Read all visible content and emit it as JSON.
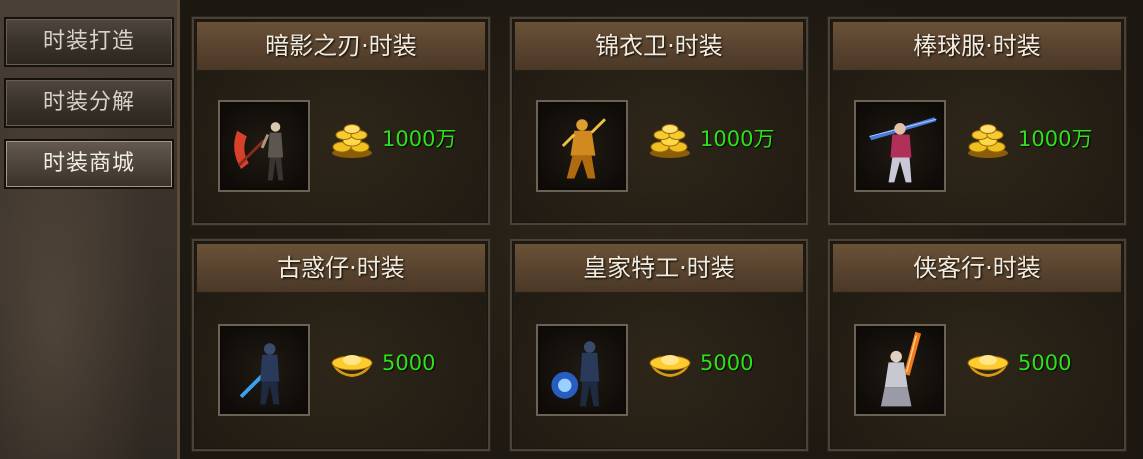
{
  "sidebar": {
    "tabs": [
      {
        "label": "时装打造",
        "active": false
      },
      {
        "label": "时装分解",
        "active": false
      },
      {
        "label": "时装商城",
        "active": true
      }
    ]
  },
  "shop": {
    "items": [
      {
        "name": "暗影之刃·时装",
        "price": "1000万",
        "currency_icon": "gold-coins-icon",
        "portrait_icon": "scythe-warrior-icon"
      },
      {
        "name": "锦衣卫·时装",
        "price": "1000万",
        "currency_icon": "gold-coins-icon",
        "portrait_icon": "golden-warrior-icon"
      },
      {
        "name": "棒球服·时装",
        "price": "1000万",
        "currency_icon": "gold-coins-icon",
        "portrait_icon": "sword-fighter-icon"
      },
      {
        "name": "古惑仔·时装",
        "price": "5000",
        "currency_icon": "gold-ingot-icon",
        "portrait_icon": "blue-blade-warrior-icon"
      },
      {
        "name": "皇家特工·时装",
        "price": "5000",
        "currency_icon": "gold-ingot-icon",
        "portrait_icon": "blue-flame-warrior-icon"
      },
      {
        "name": "侠客行·时装",
        "price": "5000",
        "currency_icon": "gold-ingot-icon",
        "portrait_icon": "flame-sword-warrior-icon"
      }
    ]
  },
  "colors": {
    "price_text": "#2fe01c",
    "header_bg": "#5a4430",
    "title_text": "#f3ecdd"
  }
}
